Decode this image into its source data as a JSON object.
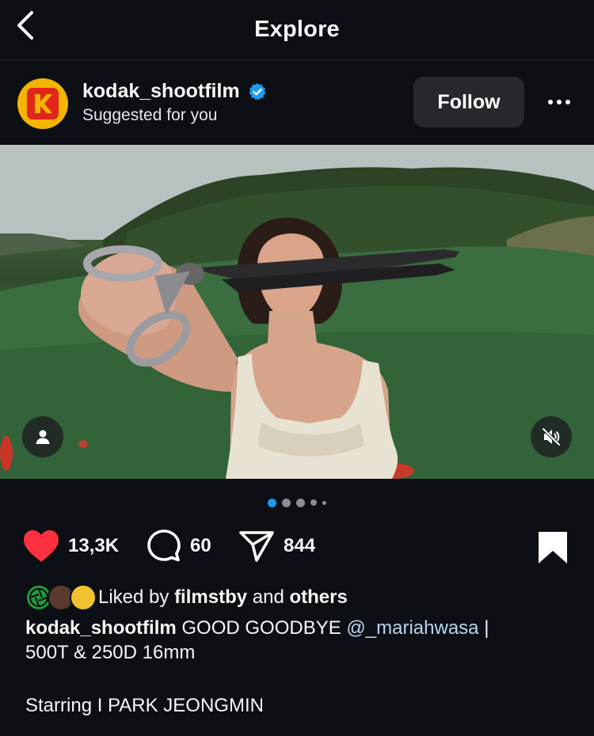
{
  "topbar": {
    "title": "Explore"
  },
  "post": {
    "username": "kodak_shootfilm",
    "verified": true,
    "subtitle": "Suggested for you",
    "follow_label": "Follow",
    "brand_colors": {
      "avatar_bg": "#f4b400",
      "logo_red": "#e1261c"
    }
  },
  "carousel": {
    "total": 5,
    "active_index": 0,
    "active_color": "#1d9bf0"
  },
  "actions": {
    "likes": "13,3K",
    "comments": "60",
    "shares": "844",
    "like_color": "#ff3040"
  },
  "likes_line": {
    "prefix": "Liked by",
    "user": "filmstby",
    "conjunction": "and",
    "others": "others"
  },
  "caption": {
    "username": "kodak_shootfilm",
    "text_before": "GOOD GOODBYE",
    "mention": "@_mariahwasa",
    "text_after": "|",
    "line2": "500T & 250D 16mm",
    "line3": "Starring I PARK JEONGMIN"
  }
}
